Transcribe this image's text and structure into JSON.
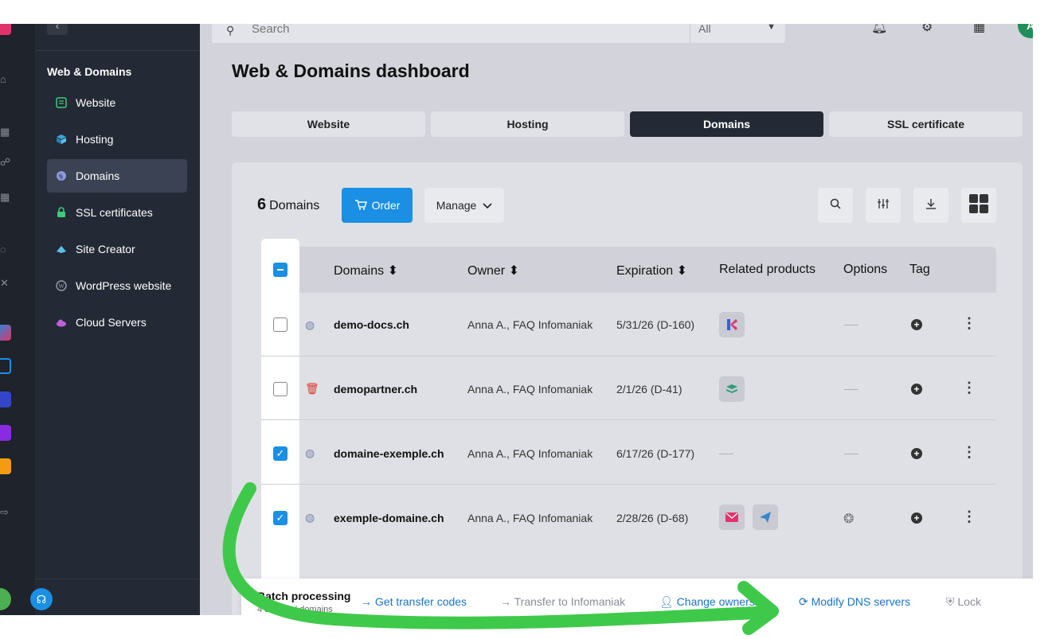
{
  "topbar": {
    "search_placeholder": "Search",
    "scope_value": "All",
    "avatar_initial": "A"
  },
  "sidebar": {
    "heading": "Web & Domains",
    "items": [
      {
        "label": "Website"
      },
      {
        "label": "Hosting"
      },
      {
        "label": "Domains",
        "active": true
      },
      {
        "label": "SSL certificates"
      },
      {
        "label": "Site Creator"
      },
      {
        "label": "WordPress website"
      },
      {
        "label": "Cloud Servers"
      }
    ]
  },
  "page": {
    "title": "Web & Domains dashboard"
  },
  "tabs": [
    {
      "label": "Website"
    },
    {
      "label": "Hosting"
    },
    {
      "label": "Domains",
      "active": true
    },
    {
      "label": "SSL certificate"
    }
  ],
  "toolbar": {
    "count": "6",
    "count_label": "Domains",
    "order_label": "Order",
    "manage_label": "Manage"
  },
  "table": {
    "headers": {
      "domains": "Domains",
      "owner": "Owner",
      "expiration": "Expiration",
      "related": "Related products",
      "options": "Options",
      "tag": "Tag"
    },
    "rows": [
      {
        "domain": "demo-docs.ch",
        "owner": "Anna A., FAQ Infomaniak",
        "expiration": "5/31/26 (D-160)",
        "checked": false
      },
      {
        "domain": "demopartner.ch",
        "owner": "Anna A., FAQ Infomaniak",
        "expiration": "2/1/26 (D-41)",
        "checked": false
      },
      {
        "domain": "domaine-exemple.ch",
        "owner": "Anna A., FAQ Infomaniak",
        "expiration": "6/17/26 (D-177)",
        "checked": true
      },
      {
        "domain": "exemple-domaine.ch",
        "owner": "Anna A., FAQ Infomaniak",
        "expiration": "2/28/26 (D-68)",
        "checked": true
      }
    ]
  },
  "batch": {
    "title": "Batch processing",
    "subtitle": "4 selected domains",
    "actions": [
      {
        "label": "Get transfer codes"
      },
      {
        "label": "Transfer to Infomaniak"
      },
      {
        "label": "Change ownership"
      },
      {
        "label": "Modify DNS servers"
      },
      {
        "label": "Lock"
      }
    ]
  },
  "colors": {
    "accent": "#1a8fe3",
    "sidebar_bg": "#232a35",
    "annotation_arrow": "#3fc94a"
  }
}
